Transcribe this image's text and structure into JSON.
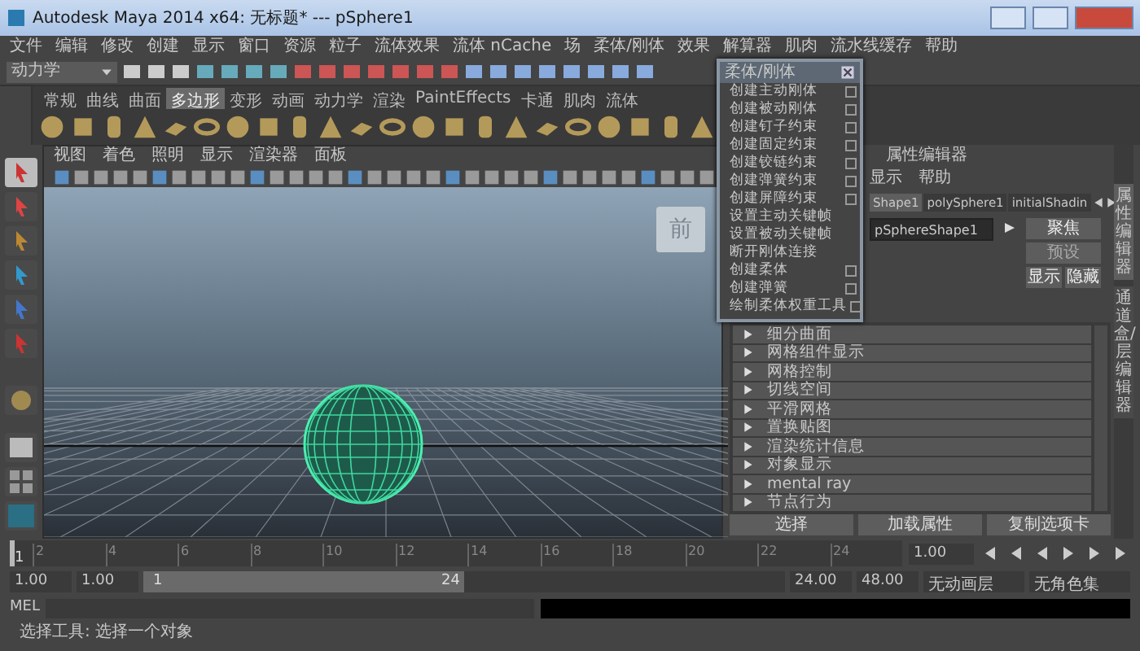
{
  "window": {
    "title": "Autodesk Maya 2014 x64: 无标题*   ---   pSphere1"
  },
  "menus": [
    "文件",
    "编辑",
    "修改",
    "创建",
    "显示",
    "窗口",
    "资源",
    "粒子",
    "流体效果",
    "流体 nCache",
    "场",
    "柔体/刚体",
    "效果",
    "解算器",
    "肌肉",
    "流水线缓存",
    "帮助"
  ],
  "mode": "动力学",
  "shelf_tabs": [
    {
      "label": "常规",
      "selected": false
    },
    {
      "label": "曲线",
      "selected": false
    },
    {
      "label": "曲面",
      "selected": false
    },
    {
      "label": "多边形",
      "selected": true
    },
    {
      "label": "变形",
      "selected": false
    },
    {
      "label": "动画",
      "selected": false
    },
    {
      "label": "动力学",
      "selected": false
    },
    {
      "label": "渲染",
      "selected": false
    },
    {
      "label": "PaintEffects",
      "selected": false
    },
    {
      "label": "卡通",
      "selected": false
    },
    {
      "label": "肌肉",
      "selected": false
    },
    {
      "label": "流体",
      "selected": false
    }
  ],
  "panel_menus": [
    "视图",
    "着色",
    "照明",
    "显示",
    "渲染器",
    "面板"
  ],
  "viewcube": {
    "label": "前"
  },
  "popup_menu": {
    "title": "柔体/刚体",
    "items": [
      {
        "label": "创建主动刚体",
        "option_box": true
      },
      {
        "label": "创建被动刚体",
        "option_box": true
      },
      {
        "label": "创建钉子约束",
        "option_box": true
      },
      {
        "label": "创建固定约束",
        "option_box": true
      },
      {
        "label": "创建铰链约束",
        "option_box": true
      },
      {
        "label": "创建弹簧约束",
        "option_box": true
      },
      {
        "label": "创建屏障约束",
        "option_box": true
      },
      {
        "label": "设置主动关键帧",
        "option_box": false
      },
      {
        "label": "设置被动关键帧",
        "option_box": false
      },
      {
        "label": "断开刚体连接",
        "option_box": false
      },
      {
        "label": "创建柔体",
        "option_box": true
      },
      {
        "label": "创建弹簧",
        "option_box": true
      },
      {
        "label": "绘制柔体权重工具",
        "option_box": true
      }
    ]
  },
  "attribute_editor": {
    "title": "属性编辑器",
    "menus": [
      "显示",
      "帮助"
    ],
    "tabs": [
      {
        "label": "Shape1",
        "selected": true
      },
      {
        "label": "polySphere1",
        "selected": false
      },
      {
        "label": "initialShadin",
        "selected": false
      }
    ],
    "node_name": "pSphereShape1",
    "buttons": [
      {
        "label": "聚焦",
        "disabled": false
      },
      {
        "label": "预设",
        "disabled": true
      },
      {
        "label": "显示",
        "disabled": false
      },
      {
        "label": "隐藏",
        "disabled": false
      }
    ],
    "sections": [
      {
        "label": "细分曲面",
        "expanded": false
      },
      {
        "label": "网格组件显示",
        "expanded": false
      },
      {
        "label": "网格控制",
        "expanded": false
      },
      {
        "label": "切线空间",
        "expanded": false
      },
      {
        "label": "平滑网格",
        "expanded": false
      },
      {
        "label": "置换贴图",
        "expanded": false
      },
      {
        "label": "渲染统计信息",
        "expanded": false
      },
      {
        "label": "对象显示",
        "expanded": false
      },
      {
        "label": "mental ray",
        "expanded": false
      },
      {
        "label": "节点行为",
        "expanded": false
      }
    ],
    "bottom_buttons": [
      "选择",
      "加载属性",
      "复制选项卡"
    ]
  },
  "side_tabs": [
    {
      "label": "属性编辑器",
      "selected": true
    },
    {
      "label": "通道盒/层编辑器",
      "selected": false
    }
  ],
  "timeline": {
    "ticks": [
      "2",
      "4",
      "6",
      "8",
      "10",
      "12",
      "14",
      "16",
      "18",
      "20",
      "22",
      "24"
    ],
    "current": "1",
    "current_field": "1.00",
    "level": 0.0
  },
  "range": {
    "start": "1.00",
    "playback_start": "1.00",
    "bar_start": "1",
    "bar_end": "24",
    "level": 0.5,
    "playback_end": "24.00",
    "end": "48.00",
    "anim_layer": "无动画层",
    "character_set": "无角色集"
  },
  "command_line": {
    "label": "MEL"
  },
  "help_line": "选择工具: 选择一个对象"
}
